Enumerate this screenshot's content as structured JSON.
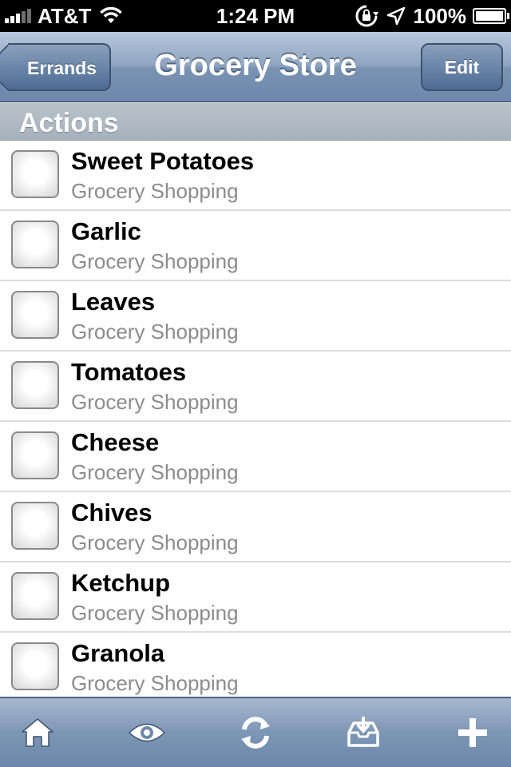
{
  "status_bar": {
    "carrier": "AT&T",
    "time": "1:24 PM",
    "battery": "100%",
    "icons": [
      "signal-bars-icon",
      "wifi-icon",
      "rotation-lock-icon",
      "location-arrow-icon",
      "battery-icon"
    ]
  },
  "nav": {
    "title": "Grocery Store",
    "back_label": "Errands",
    "edit_label": "Edit"
  },
  "section": {
    "title": "Actions"
  },
  "items": [
    {
      "title": "Sweet Potatoes",
      "subtitle": "Grocery Shopping"
    },
    {
      "title": "Garlic",
      "subtitle": "Grocery Shopping"
    },
    {
      "title": "Leaves",
      "subtitle": "Grocery Shopping"
    },
    {
      "title": "Tomatoes",
      "subtitle": "Grocery Shopping"
    },
    {
      "title": "Cheese",
      "subtitle": "Grocery Shopping"
    },
    {
      "title": "Chives",
      "subtitle": "Grocery Shopping"
    },
    {
      "title": "Ketchup",
      "subtitle": "Grocery Shopping"
    },
    {
      "title": "Granola",
      "subtitle": "Grocery Shopping"
    }
  ],
  "toolbar": {
    "icons": [
      "home-icon",
      "eye-icon",
      "sync-icon",
      "inbox-icon",
      "plus-icon"
    ]
  },
  "colors": {
    "nav_bar": "#7a93b3",
    "section_header": "#a6b1bc",
    "subtitle_text": "#8c8c8c"
  }
}
